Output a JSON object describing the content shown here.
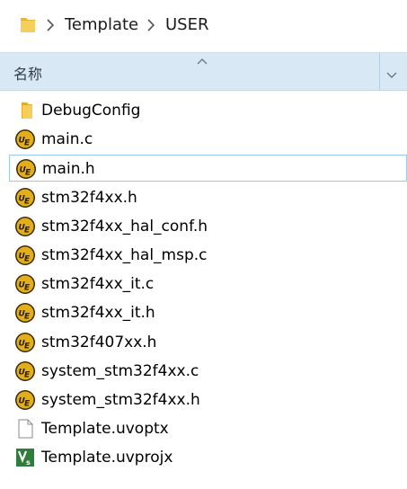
{
  "address_bar": {
    "breadcrumbs": [
      "Template",
      "USER"
    ],
    "icon": "folder-icon"
  },
  "header": {
    "name_column": "名称",
    "sort": "ascending"
  },
  "colors": {
    "header_bg": "#d9e8f5",
    "hover_border": "#99c9ef",
    "folder": "#f3c64f",
    "ue_icon": "#d9a514",
    "uv_icon": "#2f7d3a"
  },
  "files": [
    {
      "name": "DebugConfig",
      "icon": "folder-icon"
    },
    {
      "name": "main.c",
      "icon": "ultraedit-icon"
    },
    {
      "name": "main.h",
      "icon": "ultraedit-icon",
      "hovered": true
    },
    {
      "name": "stm32f4xx.h",
      "icon": "ultraedit-icon"
    },
    {
      "name": "stm32f4xx_hal_conf.h",
      "icon": "ultraedit-icon"
    },
    {
      "name": "stm32f4xx_hal_msp.c",
      "icon": "ultraedit-icon"
    },
    {
      "name": "stm32f4xx_it.c",
      "icon": "ultraedit-icon"
    },
    {
      "name": "stm32f4xx_it.h",
      "icon": "ultraedit-icon"
    },
    {
      "name": "stm32f407xx.h",
      "icon": "ultraedit-icon"
    },
    {
      "name": "system_stm32f4xx.c",
      "icon": "ultraedit-icon"
    },
    {
      "name": "system_stm32f4xx.h",
      "icon": "ultraedit-icon"
    },
    {
      "name": "Template.uvoptx",
      "icon": "blank-file-icon"
    },
    {
      "name": "Template.uvprojx",
      "icon": "keil-uvision-icon"
    }
  ]
}
